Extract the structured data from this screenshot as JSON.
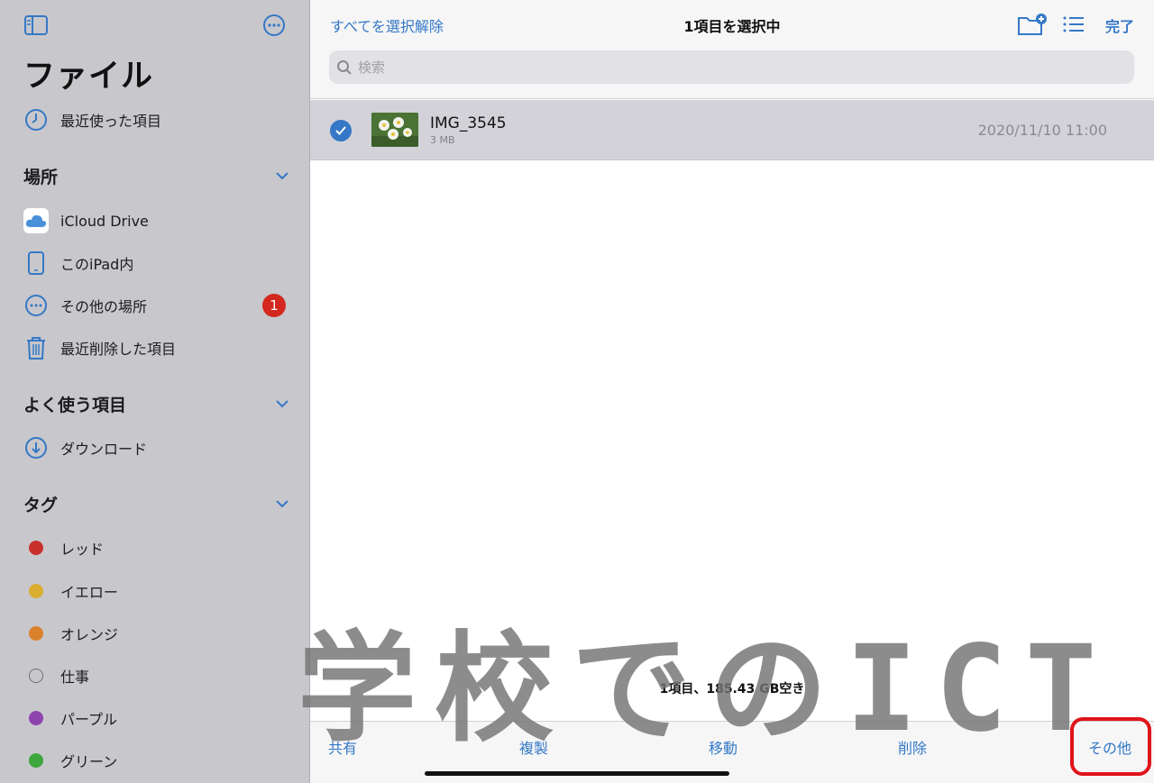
{
  "sidebar": {
    "title": "ファイル",
    "recents_label": "最近使った項目",
    "locations": {
      "header": "場所",
      "items": [
        {
          "label": "iCloud Drive"
        },
        {
          "label": "このiPad内"
        },
        {
          "label": "その他の場所",
          "badge": "1"
        },
        {
          "label": "最近削除した項目"
        }
      ]
    },
    "favorites": {
      "header": "よく使う項目",
      "items": [
        {
          "label": "ダウンロード"
        }
      ]
    },
    "tags": {
      "header": "タグ",
      "items": [
        {
          "label": "レッド",
          "color": "#c9302c"
        },
        {
          "label": "イエロー",
          "color": "#d9ad30"
        },
        {
          "label": "オレンジ",
          "color": "#d9822b"
        },
        {
          "label": "仕事",
          "color": "none"
        },
        {
          "label": "パープル",
          "color": "#8e44ad"
        },
        {
          "label": "グリーン",
          "color": "#3da63d"
        }
      ]
    }
  },
  "toolbar": {
    "deselect_all": "すべてを選択解除",
    "title": "1項目を選択中",
    "done": "完了"
  },
  "search": {
    "placeholder": "検索"
  },
  "files": [
    {
      "name": "IMG_3545",
      "size": "3 MB",
      "date": "2020/11/10 11:00",
      "selected": true
    }
  ],
  "status": "1項目、185.43 GB空き",
  "actions": {
    "share": "共有",
    "duplicate": "複製",
    "move": "移動",
    "delete": "削除",
    "more": "その他"
  },
  "watermark": "学校でのICT",
  "colors": {
    "accent": "#3478c6",
    "badge": "#d4271d",
    "highlight": "#e0141b"
  }
}
